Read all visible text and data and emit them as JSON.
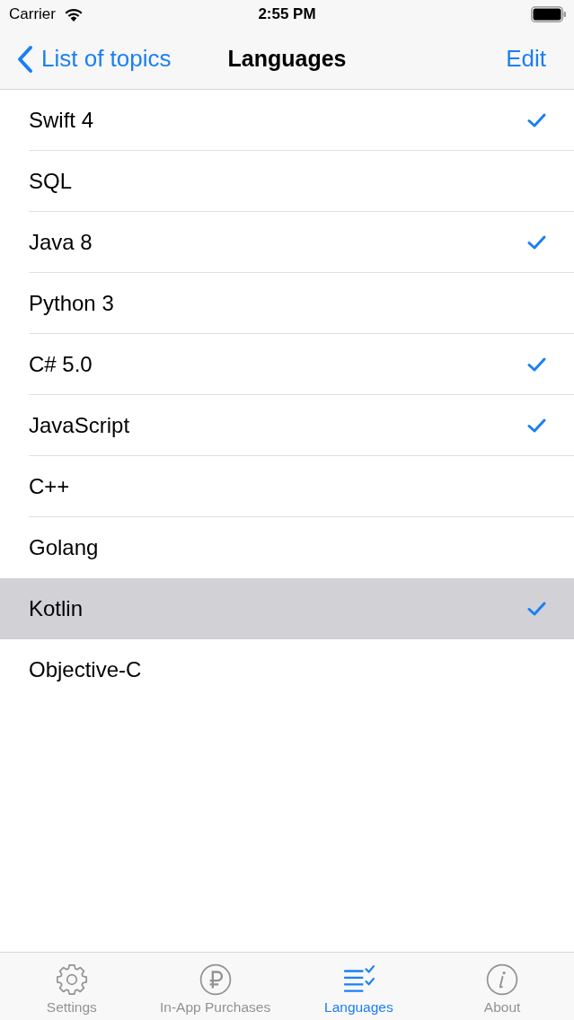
{
  "status_bar": {
    "carrier": "Carrier",
    "time": "2:55 PM"
  },
  "nav_bar": {
    "back": "List of topics",
    "title": "Languages",
    "action": "Edit"
  },
  "rows": [
    {
      "label": "Swift 4",
      "checked": true,
      "selected": false
    },
    {
      "label": "SQL",
      "checked": false,
      "selected": false
    },
    {
      "label": "Java 8",
      "checked": true,
      "selected": false
    },
    {
      "label": "Python 3",
      "checked": false,
      "selected": false
    },
    {
      "label": "C# 5.0",
      "checked": true,
      "selected": false
    },
    {
      "label": "JavaScript",
      "checked": true,
      "selected": false
    },
    {
      "label": "C++",
      "checked": false,
      "selected": false
    },
    {
      "label": "Golang",
      "checked": false,
      "selected": false
    },
    {
      "label": "Kotlin",
      "checked": true,
      "selected": true
    },
    {
      "label": "Objective-C",
      "checked": false,
      "selected": false
    }
  ],
  "tab_bar": {
    "tabs": [
      {
        "label": "Settings",
        "selected": false
      },
      {
        "label": "In-App Purchases",
        "selected": false
      },
      {
        "label": "Languages",
        "selected": true
      },
      {
        "label": "About",
        "selected": false
      }
    ]
  }
}
